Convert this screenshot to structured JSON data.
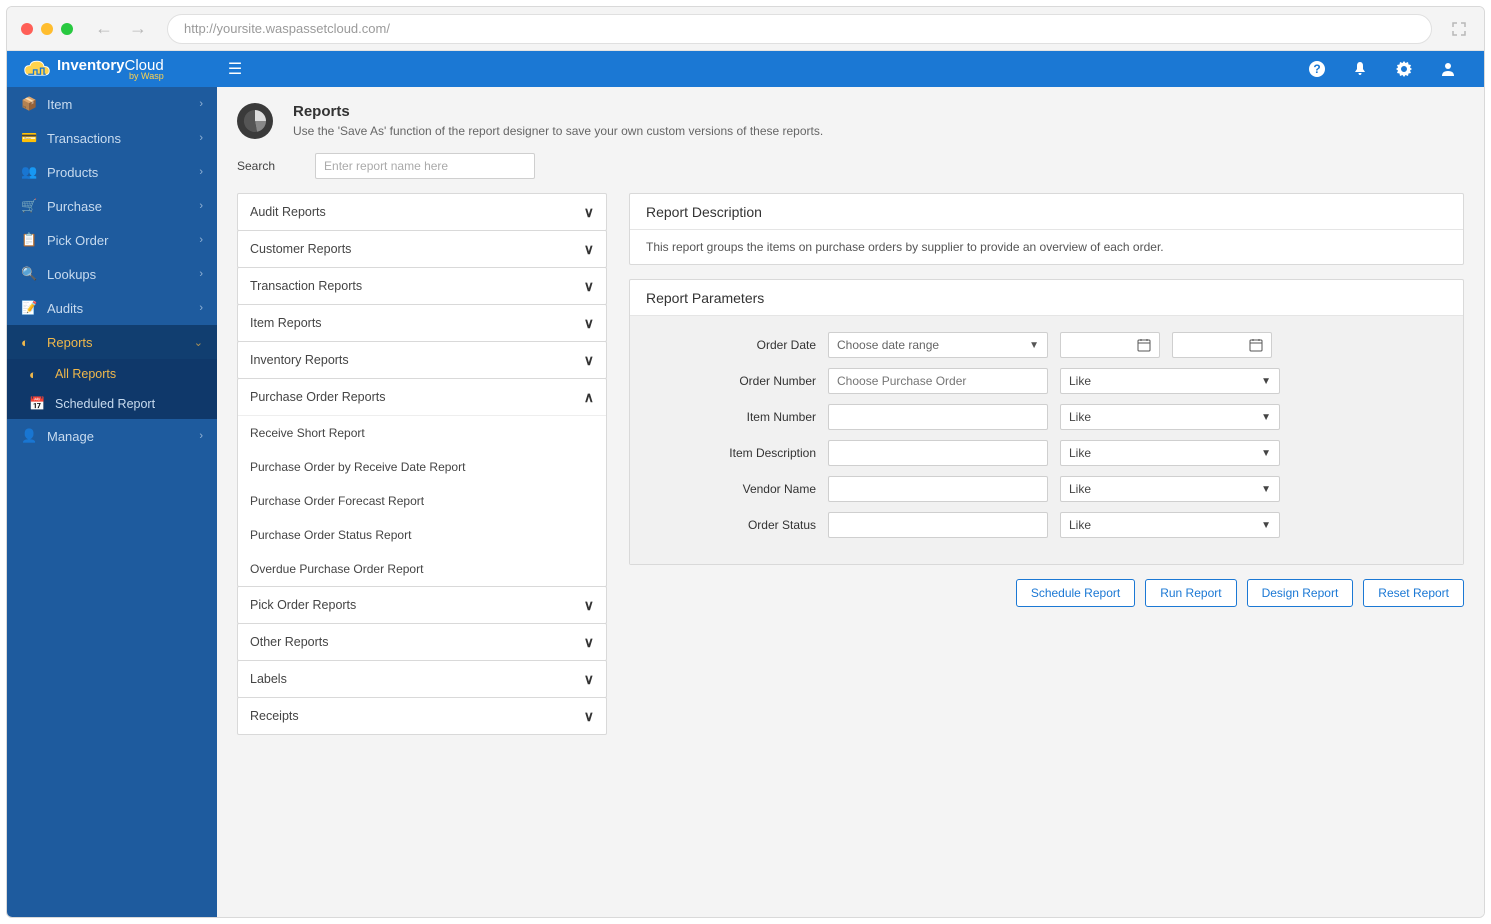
{
  "browser": {
    "url": "http://yoursite.waspassetcloud.com/"
  },
  "logo": {
    "name1": "Inventory",
    "name2": "Cloud",
    "sub": "by Wasp"
  },
  "sidebar": {
    "items": [
      {
        "label": "Item"
      },
      {
        "label": "Transactions"
      },
      {
        "label": "Products"
      },
      {
        "label": "Purchase"
      },
      {
        "label": "Pick Order"
      },
      {
        "label": "Lookups"
      },
      {
        "label": "Audits"
      },
      {
        "label": "Reports"
      },
      {
        "label": "Manage"
      }
    ],
    "reports_sub": [
      {
        "label": "All Reports"
      },
      {
        "label": "Scheduled Report"
      }
    ]
  },
  "page": {
    "title": "Reports",
    "subtitle": "Use the 'Save As' function of the report designer to save your own custom versions of these reports.",
    "search_label": "Search",
    "search_placeholder": "Enter report name here"
  },
  "categories": [
    {
      "label": "Audit Reports",
      "open": false
    },
    {
      "label": "Customer Reports",
      "open": false
    },
    {
      "label": "Transaction Reports",
      "open": false
    },
    {
      "label": "Item Reports",
      "open": false
    },
    {
      "label": "Inventory Reports",
      "open": false
    },
    {
      "label": "Purchase Order Reports",
      "open": true,
      "items": [
        "Receive Short Report",
        "Purchase Order by Receive Date Report",
        "Purchase Order Forecast Report",
        "Purchase Order Status Report",
        "Overdue Purchase Order Report"
      ]
    },
    {
      "label": "Pick Order Reports",
      "open": false
    },
    {
      "label": "Other Reports",
      "open": false
    },
    {
      "label": "Labels",
      "open": false
    },
    {
      "label": "Receipts",
      "open": false
    }
  ],
  "description": {
    "title": "Report Description",
    "text": "This report groups the items on purchase orders by supplier to provide an overview of each order."
  },
  "parameters": {
    "title": "Report Parameters",
    "rows": [
      {
        "label": "Order Date",
        "select": "Choose date range",
        "type": "daterange"
      },
      {
        "label": "Order Number",
        "placeholder": "Choose Purchase Order",
        "op": "Like",
        "type": "text"
      },
      {
        "label": "Item Number",
        "placeholder": "",
        "op": "Like",
        "type": "text"
      },
      {
        "label": "Item Description",
        "placeholder": "",
        "op": "Like",
        "type": "text"
      },
      {
        "label": "Vendor Name",
        "placeholder": "",
        "op": "Like",
        "type": "text"
      },
      {
        "label": "Order Status",
        "placeholder": "",
        "op": "Like",
        "type": "text"
      }
    ]
  },
  "buttons": {
    "schedule": "Schedule Report",
    "run": "Run Report",
    "design": "Design Report",
    "reset": "Reset Report"
  }
}
